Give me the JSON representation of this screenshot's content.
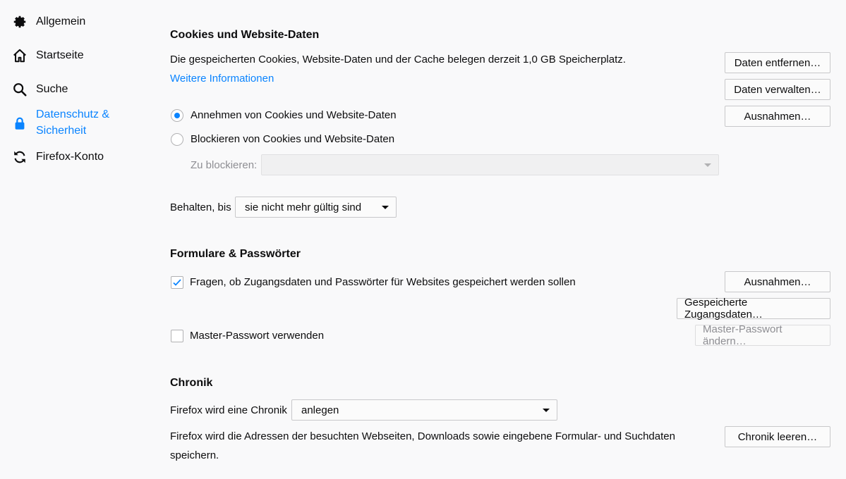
{
  "sidebar": {
    "items": [
      {
        "label": "Allgemein",
        "icon": "gear-icon"
      },
      {
        "label": "Startseite",
        "icon": "home-icon"
      },
      {
        "label": "Suche",
        "icon": "search-icon"
      },
      {
        "label": "Datenschutz &",
        "label2": "Sicherheit",
        "icon": "lock-icon",
        "active": true
      },
      {
        "label": "Firefox-Konto",
        "icon": "sync-icon"
      }
    ]
  },
  "colors": {
    "accent": "#0a84ff",
    "text": "#0c0c0d",
    "background": "#f9f9fa"
  },
  "cookies": {
    "heading": "Cookies und Website-Daten",
    "description": "Die gespeicherten Cookies, Website-Daten und der Cache belegen derzeit 1,0 GB Speicherplatz.",
    "more_info": "Weitere Informationen",
    "accept_label": "Annehmen von Cookies und Website-Daten",
    "block_label": "Blockieren von Cookies und Website-Daten",
    "block_select_label": "Zu blockieren:",
    "block_select_value": "",
    "keep_label": "Behalten, bis",
    "keep_value": "sie nicht mehr gültig sind",
    "btn_clear": "Daten entfernen…",
    "btn_manage": "Daten verwalten…",
    "btn_exceptions": "Ausnahmen…"
  },
  "forms": {
    "heading": "Formulare & Passwörter",
    "ask_label": "Fragen, ob Zugangsdaten und Passwörter für Websites gespeichert werden sollen",
    "master_label": "Master-Passwort verwenden",
    "btn_exceptions": "Ausnahmen…",
    "btn_saved": "Gespeicherte Zugangsdaten…",
    "btn_master": "Master-Passwort ändern…"
  },
  "history": {
    "heading": "Chronik",
    "mode_label": "Firefox wird eine Chronik",
    "mode_value": "anlegen",
    "description_line1": "Firefox wird die Adressen der besuchten Webseiten, Downloads sowie eingebene Formular- und Suchdaten",
    "description_line2": "speichern.",
    "btn_clear": "Chronik leeren…"
  }
}
